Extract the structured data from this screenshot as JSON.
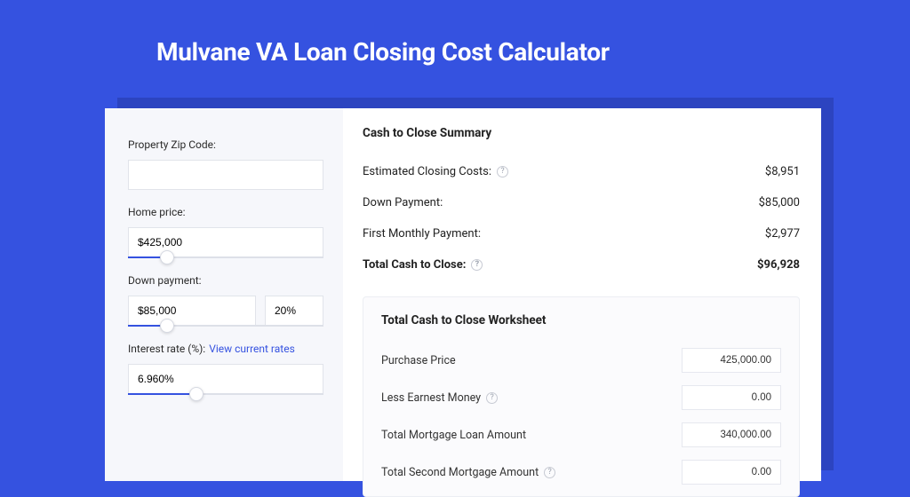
{
  "title": "Mulvane VA Loan Closing Cost Calculator",
  "left": {
    "zip_label": "Property Zip Code:",
    "zip_value": "",
    "home_price_label": "Home price:",
    "home_price_value": "$425,000",
    "home_price_slider_pct": 20,
    "down_payment_label": "Down payment:",
    "down_payment_value": "$85,000",
    "down_payment_pct": "20%",
    "down_payment_slider_pct": 20,
    "interest_label": "Interest rate (%):",
    "interest_link": "View current rates",
    "interest_value": "6.960%",
    "interest_slider_pct": 35
  },
  "summary": {
    "heading": "Cash to Close Summary",
    "rows": [
      {
        "label": "Estimated Closing Costs:",
        "help": true,
        "value": "$8,951"
      },
      {
        "label": "Down Payment:",
        "help": false,
        "value": "$85,000"
      },
      {
        "label": "First Monthly Payment:",
        "help": false,
        "value": "$2,977"
      }
    ],
    "total_label": "Total Cash to Close:",
    "total_value": "$96,928"
  },
  "worksheet": {
    "heading": "Total Cash to Close Worksheet",
    "rows": [
      {
        "label": "Purchase Price",
        "help": false,
        "value": "425,000.00"
      },
      {
        "label": "Less Earnest Money",
        "help": true,
        "value": "0.00"
      },
      {
        "label": "Total Mortgage Loan Amount",
        "help": false,
        "value": "340,000.00"
      },
      {
        "label": "Total Second Mortgage Amount",
        "help": true,
        "value": "0.00"
      }
    ]
  }
}
